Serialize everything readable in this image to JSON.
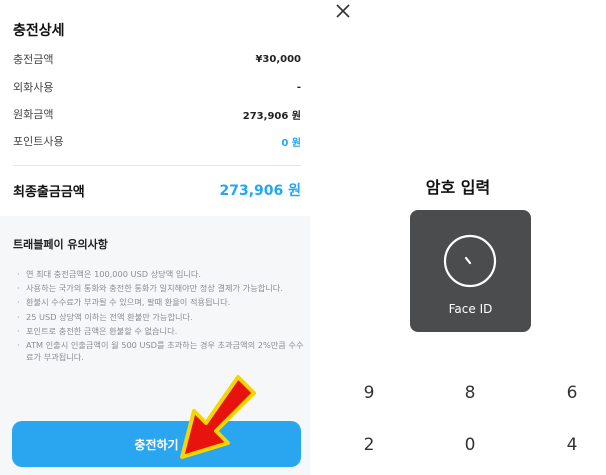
{
  "left": {
    "detail_title": "충전상세",
    "rows": [
      {
        "label": "충전금액",
        "value": "¥30,000"
      },
      {
        "label": "외화사용",
        "value": "-"
      },
      {
        "label": "원화금액",
        "value": "273,906 원"
      },
      {
        "label": "포인트사용",
        "value": "0 원"
      }
    ],
    "final_label": "최종출금금액",
    "final_value": "273,906 원",
    "notice_title": "트래블페이 유의사항",
    "notices": [
      "연 최대 충전금액은 100,000 USD 상당액 입니다.",
      "사용하는 국가의 통화와 충전한 통화가 일치해야만 정상 결제가 가능합니다.",
      "환불시 수수료가 부과될 수 있으며, 팔때 환율이 적용됩니다.",
      "25 USD 상당액 이하는 전액 환불만 가능합니다.",
      "포인트로 충전한 금액은 환불할 수 없습니다.",
      "ATM 인출시 인출금액이 월 500 USD를 초과하는 경우 초과금액의 2%만큼 수수료가 부과됩니다."
    ],
    "charge_button": "충전하기",
    "accent_color": "#22a7f0",
    "arrow_colors": [
      "#e8130f",
      "#f7d600"
    ]
  },
  "right": {
    "close_icon": "close-icon",
    "title": "암호 입력",
    "faceid_label": "Face ID",
    "keys": [
      "9",
      "8",
      "6",
      "2",
      "0",
      "4"
    ]
  }
}
